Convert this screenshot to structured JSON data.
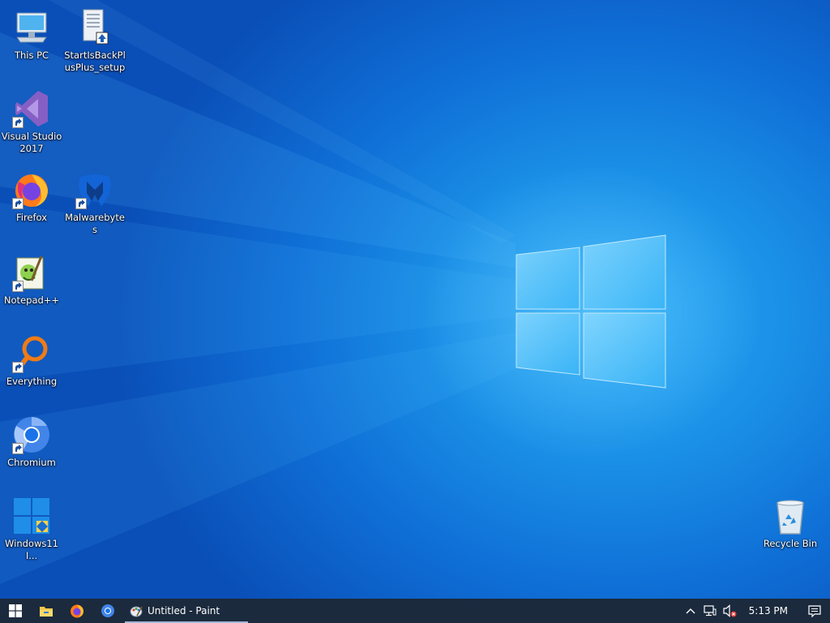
{
  "desktop": {
    "icons": [
      {
        "label": "This PC",
        "icon": "computer-icon"
      },
      {
        "label": "StartIsBackPlusPlus_setup",
        "icon": "installer-icon"
      },
      {
        "label": "Visual Studio 2017",
        "icon": "visual-studio-icon"
      },
      {
        "label": "Firefox",
        "icon": "firefox-icon"
      },
      {
        "label": "Malwarebytes",
        "icon": "malwarebytes-icon"
      },
      {
        "label": "Notepad++",
        "icon": "notepadpp-icon"
      },
      {
        "label": "Everything",
        "icon": "magnifier-icon"
      },
      {
        "label": "Chromium",
        "icon": "chromium-icon"
      },
      {
        "label": "Windows11I...",
        "icon": "windows-installer-icon"
      },
      {
        "label": "Recycle Bin",
        "icon": "recycle-bin-icon"
      }
    ]
  },
  "taskbar": {
    "start_icon": "windows-logo-icon",
    "pinned": [
      "file-explorer-icon",
      "firefox-icon",
      "chromium-icon"
    ],
    "running_app": {
      "label": "Untitled - Paint",
      "icon": "paint-icon"
    },
    "tray": {
      "icons": [
        "chevron-up-icon",
        "network-icon",
        "volume-muted-icon"
      ],
      "time": "5:13 PM",
      "notifications_icon": "action-center-icon"
    }
  },
  "colors": {
    "wallpaper": "#1a8fe6",
    "taskbar": "#1b2a3d",
    "logo_glow": "#7fd4ff"
  }
}
